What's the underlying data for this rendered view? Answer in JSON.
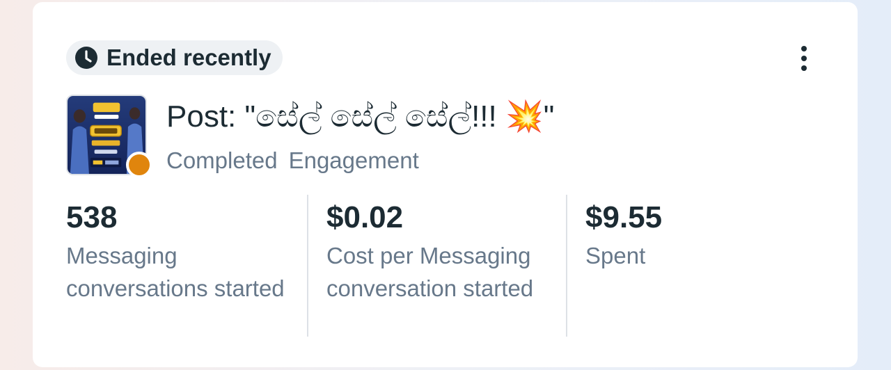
{
  "status": {
    "label": "Ended recently",
    "icon": "clock-icon"
  },
  "menu": {
    "icon": "more-vertical-icon"
  },
  "post": {
    "title": "Post: \"සේල් සේල් සේල්!!! 💥\"",
    "status": "Completed",
    "objective": "Engagement",
    "status_dot_color": "#e0850d"
  },
  "metrics": [
    {
      "value": "538",
      "label": "Messaging conversations started"
    },
    {
      "value": "$0.02",
      "label": "Cost per Messaging conversation started"
    },
    {
      "value": "$9.55",
      "label": "Spent"
    }
  ],
  "colors": {
    "text_primary": "#1c2b33",
    "text_secondary": "#67788a",
    "divider": "#dde1e6"
  }
}
